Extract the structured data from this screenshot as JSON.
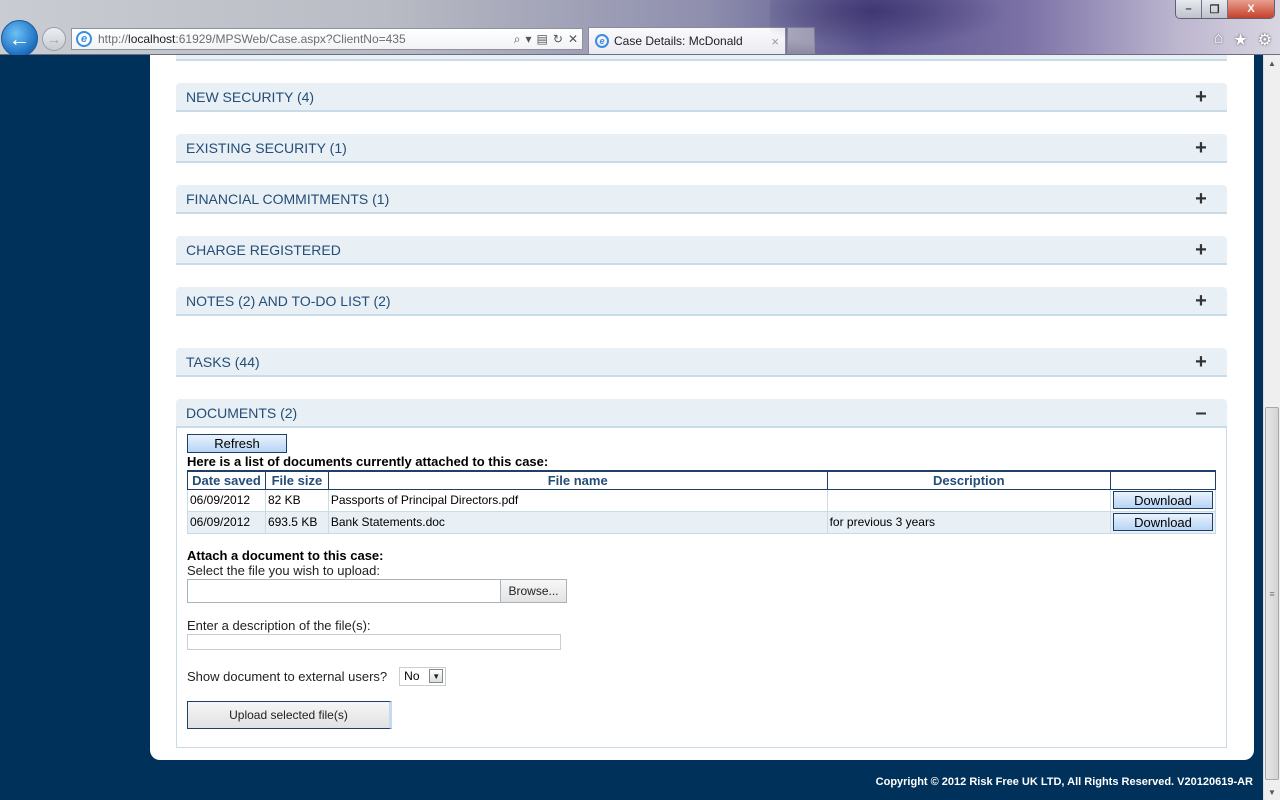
{
  "browser": {
    "address_url_prefix": "http://",
    "address_url_host": "localhost",
    "address_url_rest": ":61929/MPSWeb/Case.aspx?ClientNo=435",
    "tab_title": "Case Details: McDonald",
    "tab_close": "×",
    "icons": {
      "back": "←",
      "forward": "→",
      "search": "⌕",
      "dropdown": "▾",
      "compat": "▤",
      "refresh": "↻",
      "stop": "✕",
      "home": "⌂",
      "favorites": "★",
      "tools": "⚙",
      "minimize": "–",
      "maximize": "❐",
      "close": "X"
    }
  },
  "sections": [
    {
      "title": "NEW SECURITY (4)",
      "toggle": "+",
      "expanded": false
    },
    {
      "title": "EXISTING SECURITY (1)",
      "toggle": "+",
      "expanded": false
    },
    {
      "title": "FINANCIAL COMMITMENTS (1)",
      "toggle": "+",
      "expanded": false
    },
    {
      "title": "CHARGE REGISTERED",
      "toggle": "+",
      "expanded": false
    },
    {
      "title": "NOTES (2) AND TO-DO LIST (2)",
      "toggle": "+",
      "expanded": false
    },
    {
      "title": "TASKS (44)",
      "toggle": "+",
      "expanded": false
    },
    {
      "title": "DOCUMENTS (2)",
      "toggle": "–",
      "expanded": true
    }
  ],
  "documents": {
    "refresh_label": "Refresh",
    "intro": "Here is a list of documents currently attached to this case:",
    "columns": [
      "Date saved",
      "File size",
      "File name",
      "Description",
      ""
    ],
    "rows": [
      {
        "date": "06/09/2012",
        "size": "82 KB",
        "name": "Passports of Principal Directors.pdf",
        "description": "",
        "action": "Download"
      },
      {
        "date": "06/09/2012",
        "size": "693.5 KB",
        "name": "Bank Statements.doc",
        "description": "for previous 3 years",
        "action": "Download"
      }
    ],
    "attach_title": "Attach a document to this case:",
    "select_file_label": "Select the file you wish to upload:",
    "file_input_value": "",
    "browse_label": "Browse...",
    "description_label": "Enter a description of the file(s):",
    "description_value": "",
    "external_label": "Show document to external users?",
    "external_value": "No",
    "upload_label": "Upload selected file(s)"
  },
  "footer": {
    "copyright": "Copyright © 2012 Risk Free UK LTD, All Rights Reserved. V20120619-AR"
  },
  "scrollbar": {
    "up_icon": "▲",
    "down_icon": "▼",
    "grip_icon": "≡"
  }
}
